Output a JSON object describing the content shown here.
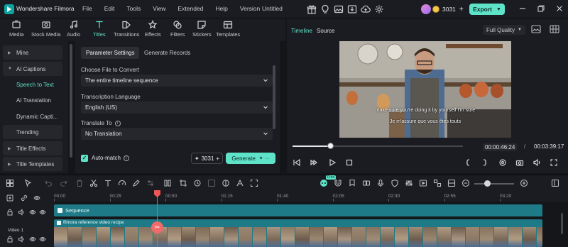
{
  "titlebar": {
    "app_name": "Wondershare Filmora",
    "menus": [
      "File",
      "Edit",
      "Tools",
      "View",
      "Extended",
      "Help",
      "Version"
    ],
    "project_name": "Untitled",
    "credits": "3031",
    "export_label": "Export"
  },
  "toolbar": {
    "tabs": [
      {
        "label": "Media",
        "icon": "media-icon"
      },
      {
        "label": "Stock Media",
        "icon": "stock-media-icon"
      },
      {
        "label": "Audio",
        "icon": "audio-icon"
      },
      {
        "label": "Titles",
        "icon": "titles-icon",
        "active": true
      },
      {
        "label": "Transitions",
        "icon": "transitions-icon"
      },
      {
        "label": "Effects",
        "icon": "effects-icon"
      },
      {
        "label": "Filters",
        "icon": "filters-icon"
      },
      {
        "label": "Stickers",
        "icon": "stickers-icon"
      },
      {
        "label": "Templates",
        "icon": "templates-icon"
      }
    ]
  },
  "sidebar": {
    "items": [
      {
        "label": "Mine",
        "type": "group"
      },
      {
        "label": "AI Captions",
        "type": "group-open"
      },
      {
        "label": "Speech to Text",
        "type": "selected"
      },
      {
        "label": "AI Translation",
        "type": "sub"
      },
      {
        "label": "Dynamic Capti...",
        "type": "sub"
      },
      {
        "label": "Trending",
        "type": "group-plain"
      },
      {
        "label": "Title Effects",
        "type": "group"
      },
      {
        "label": "Title Templates",
        "type": "group"
      }
    ]
  },
  "params": {
    "tabs": [
      "Parameter Settings",
      "Generate Records"
    ],
    "file_label": "Choose File to Convert",
    "file_value": "The entire timeline sequence",
    "lang_label": "Transcription Language",
    "lang_value": "English (US)",
    "translate_label": "Translate To",
    "translate_value": "No Translation",
    "automatch_label": "Auto-match",
    "automatch_checked": true,
    "credits": "3031",
    "generate_label": "Generate"
  },
  "player": {
    "tab_timeline": "Timeline",
    "tab_source": "Source",
    "quality": "Full Quality",
    "subtitle_en": "make sure you're doing it by yourself I'm sure",
    "subtitle_fr": "Je m'assure que vous êtes touts",
    "progress_fraction": 0.22,
    "current_time": "00:00:46:24",
    "separator": "/",
    "total_time": "00:03:39:17"
  },
  "timeline": {
    "ruler_labels": [
      "00:00",
      "00:25",
      "00:50",
      "01:15",
      "01:40",
      "02:05",
      "02:30",
      "02:55",
      "03:20"
    ],
    "sequence_label": "Sequence",
    "video_clip_label": "filmora reference video recipe",
    "track_label": "Video 1",
    "ai_badge": "Free"
  },
  "colors": {
    "accent": "#5fe3c8",
    "clip": "#1e7a86",
    "playhead": "#ef5656",
    "panel": "#1b1c21",
    "background": "#141519"
  }
}
